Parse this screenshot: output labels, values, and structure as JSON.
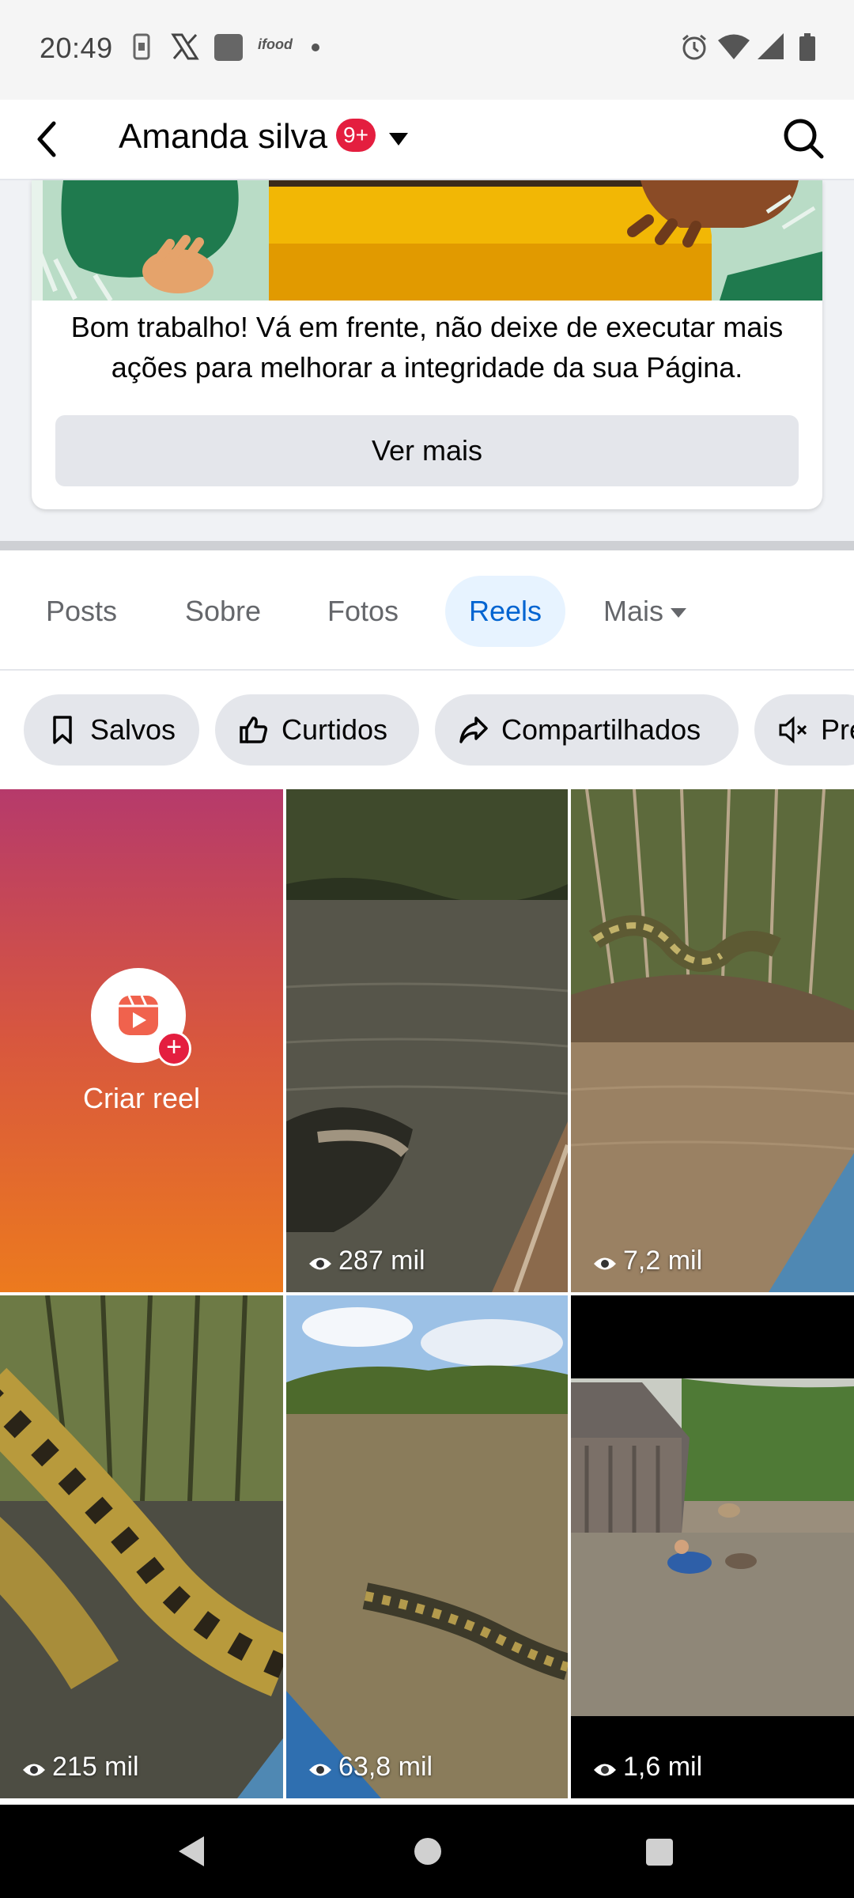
{
  "status_bar": {
    "time": "20:49",
    "left_icons": [
      "phone-icon",
      "x-logo-icon",
      "app-square-icon",
      "ifood-icon",
      "dot-icon"
    ],
    "ifood_text": "ifood",
    "right_icons": [
      "alarm-icon",
      "wifi-icon",
      "signal-icon",
      "battery-icon"
    ]
  },
  "header": {
    "title": "Amanda silva",
    "badge": "9+"
  },
  "integrity_card": {
    "message": "Bom trabalho! Vá em frente, não deixe de executar mais ações para melhorar a integridade da sua Página.",
    "button": "Ver mais"
  },
  "tabs": [
    {
      "label": "Posts",
      "active": false
    },
    {
      "label": "Sobre",
      "active": false
    },
    {
      "label": "Fotos",
      "active": false
    },
    {
      "label": "Reels",
      "active": true
    },
    {
      "label": "Mais",
      "active": false
    }
  ],
  "chips": [
    {
      "label": "Salvos",
      "icon": "bookmark-icon"
    },
    {
      "label": "Curtidos",
      "icon": "thumbs-up-icon"
    },
    {
      "label": "Compartilhados",
      "icon": "share-icon"
    },
    {
      "label": "Pre",
      "icon": "mute-icon"
    }
  ],
  "reels": {
    "create_label": "Criar reel",
    "items": [
      {
        "views": "287 mil"
      },
      {
        "views": "7,2 mil"
      },
      {
        "views": "215 mil"
      },
      {
        "views": "63,8 mil"
      },
      {
        "views": "1,6 mil"
      }
    ]
  },
  "colors": {
    "accent": "#0064d1",
    "active_tab_bg": "#e7f3ff",
    "badge": "#e41e3f",
    "chip_bg": "#e4e6eb"
  }
}
